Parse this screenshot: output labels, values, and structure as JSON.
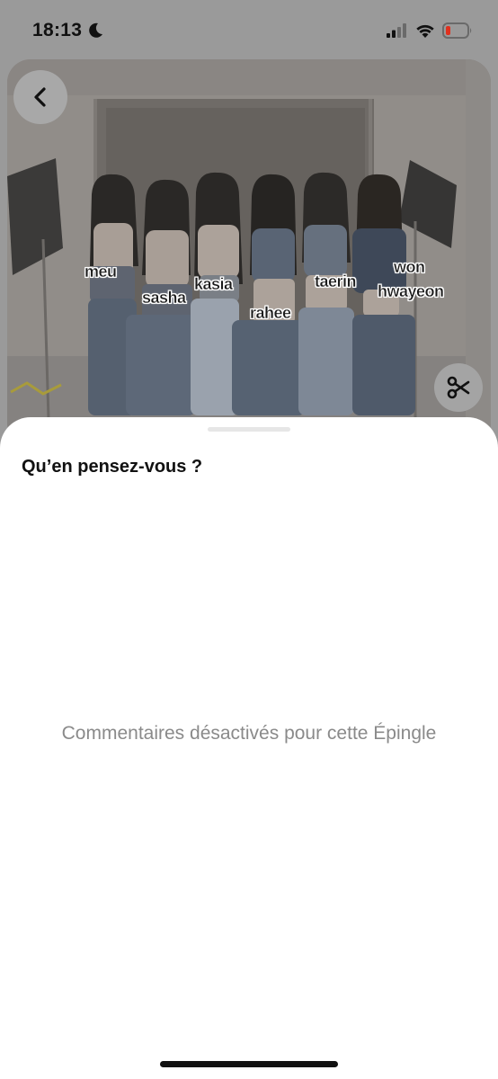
{
  "status_bar": {
    "time": "18:13",
    "icons": [
      "moon-icon",
      "signal-icon",
      "wifi-icon",
      "battery-icon"
    ],
    "battery_color": "#e0301e"
  },
  "pin": {
    "name_labels": [
      "meu",
      "sasha",
      "kasia",
      "rahee",
      "taerin",
      "won",
      "hwayeon"
    ]
  },
  "controls": {
    "back_icon": "chevron-left-icon",
    "crop_icon": "scissors-icon"
  },
  "comments_sheet": {
    "title": "Qu’en pensez-vous ?",
    "disabled_message": "Commentaires désactivés pour cette Épingle"
  }
}
